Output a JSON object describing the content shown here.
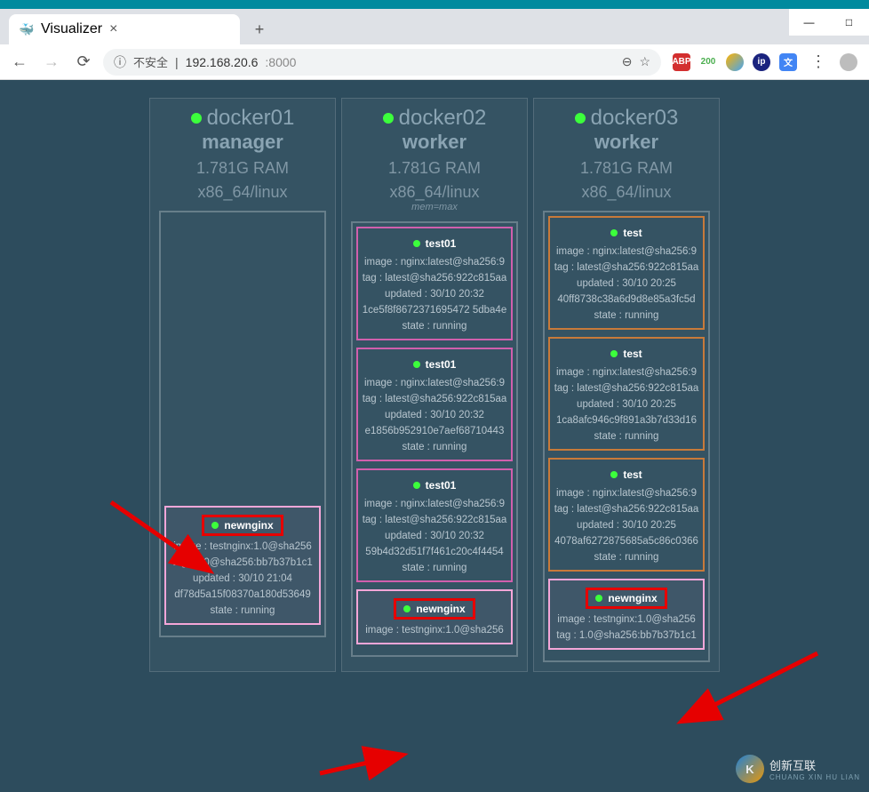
{
  "browser": {
    "tab_title": "Visualizer",
    "security_label": "不安全",
    "url_host": "192.168.20.6",
    "url_port": ":8000",
    "ext_badge": "200"
  },
  "nodes": [
    {
      "name": "docker01",
      "role": "manager",
      "ram": "1.781G RAM",
      "arch": "x86_64/linux"
    },
    {
      "name": "docker02",
      "role": "worker",
      "ram": "1.781G RAM",
      "arch": "x86_64/linux",
      "mem_note": "mem=max"
    },
    {
      "name": "docker03",
      "role": "worker",
      "ram": "1.781G RAM",
      "arch": "x86_64/linux"
    }
  ],
  "containers": {
    "col0": [
      {
        "name": "newnginx",
        "style": "highlight",
        "boxed": true,
        "lines": [
          "image : testnginx:1.0@sha256",
          "tag : 1.0@sha256:bb7b37b1c1",
          "updated : 30/10 21:04",
          "df78d5a15f08370a180d53649",
          "state : running"
        ]
      }
    ],
    "col1": [
      {
        "name": "test01",
        "style": "pink",
        "lines": [
          "image : nginx:latest@sha256:9",
          "tag : latest@sha256:922c815aa",
          "updated : 30/10 20:32",
          "1ce5f8f8672371695472 5dba4e",
          "state : running"
        ]
      },
      {
        "name": "test01",
        "style": "pink",
        "lines": [
          "image : nginx:latest@sha256:9",
          "tag : latest@sha256:922c815aa",
          "updated : 30/10 20:32",
          "e1856b952910e7aef68710443",
          "state : running"
        ]
      },
      {
        "name": "test01",
        "style": "pink",
        "lines": [
          "image : nginx:latest@sha256:9",
          "tag : latest@sha256:922c815aa",
          "updated : 30/10 20:32",
          "59b4d32d51f7f461c20c4f4454",
          "state : running"
        ]
      },
      {
        "name": "newnginx",
        "style": "highlight",
        "boxed": true,
        "lines": [
          "image : testnginx:1.0@sha256"
        ]
      }
    ],
    "col2": [
      {
        "name": "test",
        "style": "orange",
        "lines": [
          "image : nginx:latest@sha256:9",
          "tag : latest@sha256:922c815aa",
          "updated : 30/10 20:25",
          "40ff8738c38a6d9d8e85a3fc5d",
          "state : running"
        ]
      },
      {
        "name": "test",
        "style": "orange",
        "lines": [
          "image : nginx:latest@sha256:9",
          "tag : latest@sha256:922c815aa",
          "updated : 30/10 20:25",
          "1ca8afc946c9f891a3b7d33d16",
          "state : running"
        ]
      },
      {
        "name": "test",
        "style": "orange",
        "lines": [
          "image : nginx:latest@sha256:9",
          "tag : latest@sha256:922c815aa",
          "updated : 30/10 20:25",
          "4078af6272875685a5c86c0366",
          "state : running"
        ]
      },
      {
        "name": "newnginx",
        "style": "highlight",
        "boxed": true,
        "lines": [
          "image : testnginx:1.0@sha256",
          "tag : 1.0@sha256:bb7b37b1c1"
        ]
      }
    ]
  },
  "watermark": {
    "brand": "创新互联",
    "sub": "CHUANG XIN HU LIAN"
  }
}
